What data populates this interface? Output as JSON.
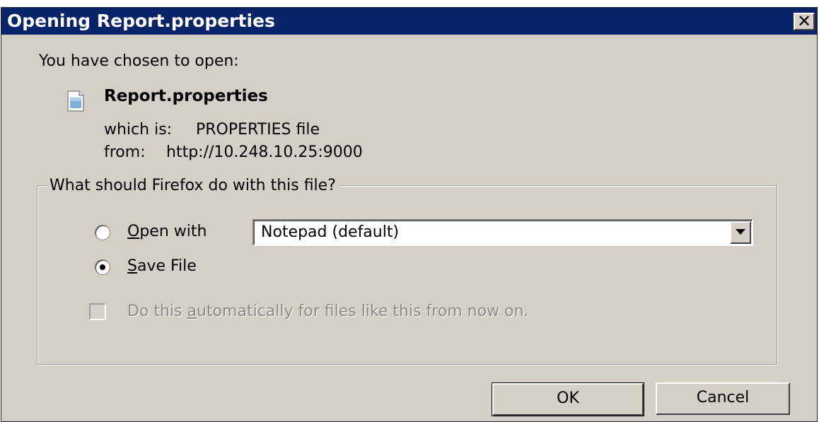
{
  "dialog": {
    "title": "Opening Report.properties",
    "close_label": "✕",
    "intro": "You have chosen to open:",
    "file": {
      "icon": "properties-file-icon",
      "name": "Report.properties",
      "type_label": "which is:",
      "type_value": "PROPERTIES file",
      "from_label": "from:",
      "from_value": "http://10.248.10.25:9000"
    },
    "group": {
      "legend": "What should Firefox do with this file?",
      "options": [
        {
          "key": "O",
          "rest": "pen with",
          "selected": false
        },
        {
          "key": "S",
          "rest": "ave File",
          "selected": true
        }
      ],
      "open_with_app": "Notepad (default)",
      "auto_checkbox": {
        "pre": "Do this ",
        "key": "a",
        "post": "utomatically for files like this from now on.",
        "checked": false,
        "disabled": true
      }
    },
    "buttons": {
      "ok": "OK",
      "cancel": "Cancel"
    }
  }
}
